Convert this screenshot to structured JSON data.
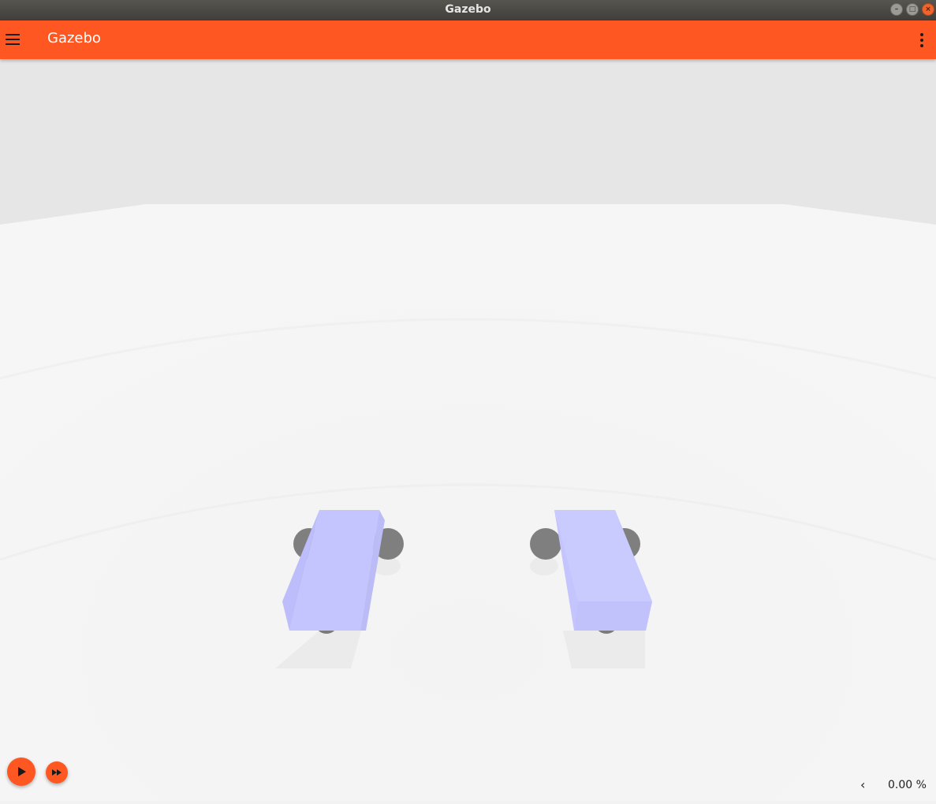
{
  "window": {
    "title": "Gazebo"
  },
  "appbar": {
    "title": "Gazebo"
  },
  "icons": {
    "menu": "hamburger-menu-icon",
    "overflow": "more-vert-icon",
    "play": "play-icon",
    "step": "fast-forward-icon",
    "collapse": "chevron-left-icon"
  },
  "status": {
    "real_time_factor": "0.00 %"
  },
  "colors": {
    "accent": "#ff5722",
    "sky": "#e6e6e6",
    "ground": "#f2f2f2",
    "robot_body": "#c5c5ff",
    "wheel": "#808080"
  }
}
